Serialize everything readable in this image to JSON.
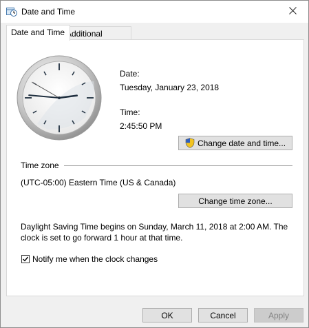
{
  "window": {
    "title": "Date and Time"
  },
  "tabs": [
    {
      "label": "Date and Time",
      "active": true
    },
    {
      "label": "Additional Clocks",
      "active": false
    }
  ],
  "datetime": {
    "date_label": "Date:",
    "date_value": "Tuesday, January 23, 2018",
    "time_label": "Time:",
    "time_value": "2:45:50 PM",
    "change_button": "Change date and time..."
  },
  "clock": {
    "hour": 2,
    "minute": 45,
    "second": 50
  },
  "timezone": {
    "group_label": "Time zone",
    "value": "(UTC-05:00) Eastern Time (US & Canada)",
    "change_button": "Change time zone..."
  },
  "dst": {
    "line1": "Daylight Saving Time begins on Sunday, March 11, 2018 at 2:00 AM. The",
    "line2": "clock is set to go forward 1 hour at that time."
  },
  "notify": {
    "label": "Notify me when the clock changes",
    "checked": true
  },
  "buttons": {
    "ok": "OK",
    "cancel": "Cancel",
    "apply": "Apply"
  },
  "icons": {
    "app": "date-time-app-icon",
    "close": "close-icon",
    "shield": "uac-shield-icon",
    "check": "checkmark-icon"
  }
}
